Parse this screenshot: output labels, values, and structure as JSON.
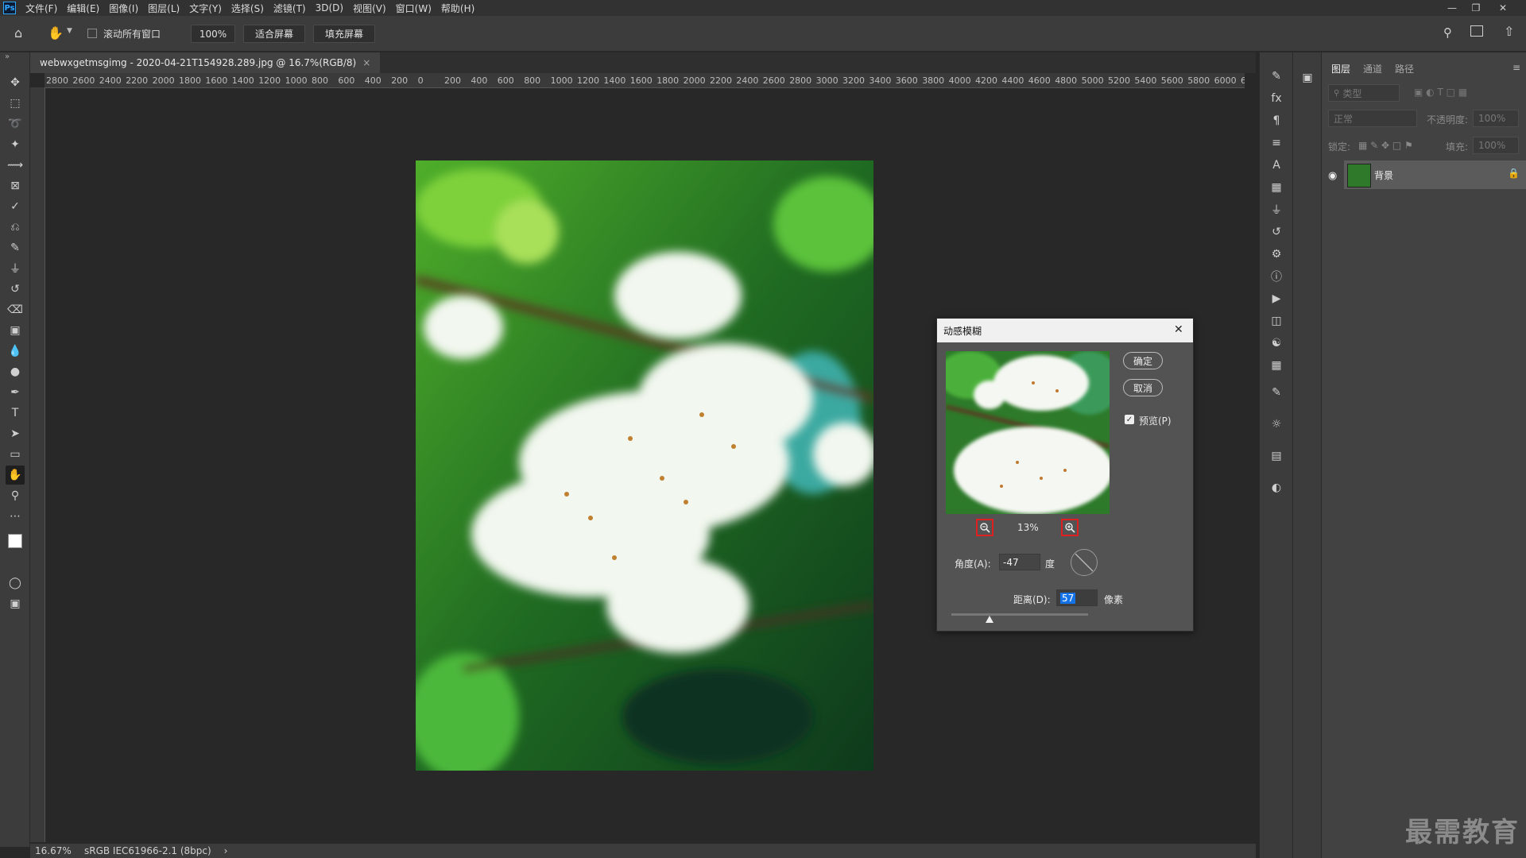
{
  "app": {
    "logo": "Ps"
  },
  "menu": [
    "文件(F)",
    "编辑(E)",
    "图像(I)",
    "图层(L)",
    "文字(Y)",
    "选择(S)",
    "滤镜(T)",
    "3D(D)",
    "视图(V)",
    "窗口(W)",
    "帮助(H)"
  ],
  "options_bar": {
    "scroll_all_label": "滚动所有窗口",
    "zoom_value": "100%",
    "fit_screen": "适合屏幕",
    "fill_screen": "填充屏幕"
  },
  "document": {
    "tab_title": "webwxgetmsgimg - 2020-04-21T154928.289.jpg @ 16.7%(RGB/8)",
    "close": "×"
  },
  "ruler": {
    "h_ticks": [
      "2800",
      "2600",
      "2400",
      "2200",
      "2000",
      "1800",
      "1600",
      "1400",
      "1200",
      "1000",
      "800",
      "600",
      "400",
      "200",
      "0",
      "200",
      "400",
      "600",
      "800",
      "1000",
      "1200",
      "1400",
      "1600",
      "1800",
      "2000",
      "2200",
      "2400",
      "2600",
      "2800",
      "3000",
      "3200",
      "3400",
      "3600",
      "3800",
      "4000",
      "4200",
      "4400",
      "4600",
      "4800",
      "5000",
      "5200",
      "5400",
      "5600",
      "5800",
      "6000",
      "6"
    ]
  },
  "status": {
    "zoom": "16.67%",
    "profile": "sRGB IEC61966-2.1 (8bpc)",
    "arrow": "›"
  },
  "layers_panel": {
    "tabs": [
      "图层",
      "通道",
      "路径"
    ],
    "filter_placeholder": "类型",
    "blend_mode": "正常",
    "opacity_label": "不透明度:",
    "opacity_value": "100%",
    "lock_label": "锁定:",
    "fill_label": "填充:",
    "fill_value": "100%",
    "layer_name": "背景"
  },
  "dialog": {
    "title": "动感模糊",
    "ok": "确定",
    "cancel": "取消",
    "preview_label": "预览(P)",
    "preview_checked": true,
    "zoom_percent": "13%",
    "angle_label": "角度(A):",
    "angle_value": "-47",
    "angle_unit": "度",
    "distance_label": "距离(D):",
    "distance_value": "57",
    "distance_unit": "像素",
    "distance_slider_fraction": 0.28
  },
  "watermark": "最需教育",
  "colors": {
    "accent": "#31a8ff",
    "highlight": "#e02020",
    "selection": "#1473e6"
  }
}
